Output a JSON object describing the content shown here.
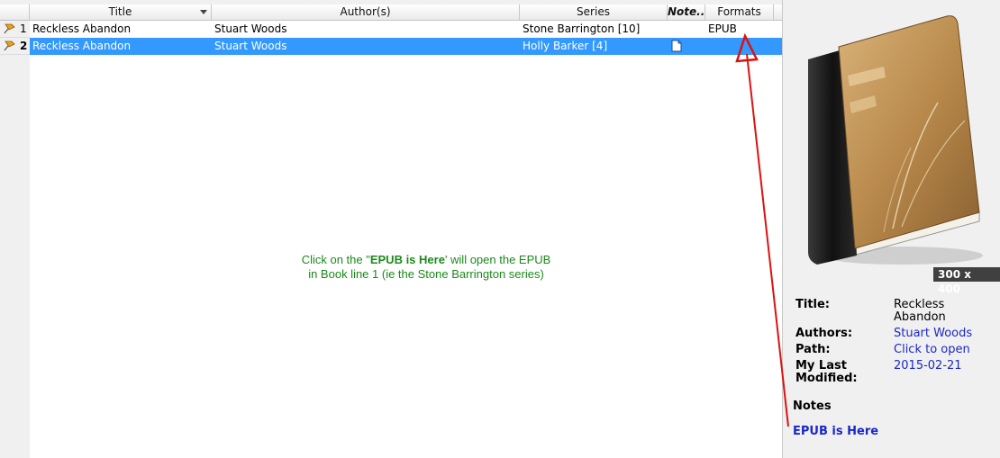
{
  "columns": {
    "title": "Title",
    "authors": "Author(s)",
    "series": "Series",
    "notes": "Note...",
    "formats": "Formats"
  },
  "rows": [
    {
      "num": "1",
      "title": "Reckless Abandon",
      "author": "Stuart Woods",
      "series": "Stone Barrington [10]",
      "formats": "EPUB",
      "has_note": false,
      "selected": false
    },
    {
      "num": "2",
      "title": "Reckless Abandon",
      "author": "Stuart Woods",
      "series": "Holly Barker [4]",
      "formats": "",
      "has_note": true,
      "selected": true
    }
  ],
  "annotation": {
    "line1_pre": "Click on the \"",
    "line1_bold": "EPUB is Here",
    "line1_post": "' will open the EPUB",
    "line2": "in Book line 1 (ie the Stone Barrington series)"
  },
  "details": {
    "cover_size": "300 x 400",
    "title_label": "Title:",
    "title_value": "Reckless Abandon",
    "authors_label": "Authors:",
    "authors_value": "Stuart Woods",
    "path_label": "Path:",
    "path_value": "Click to open",
    "modified_label": "My Last Modified:",
    "modified_value": "2015-02-21",
    "notes_heading": "Notes",
    "notes_link": "EPUB is Here"
  },
  "colors": {
    "selection": "#3399ff",
    "link": "#1a28c8",
    "annotation": "#1a8a1a",
    "arrow": "#dd1111"
  },
  "icons": {
    "row_marker": "pin-icon",
    "note": "document-icon",
    "sort": "sort-down-icon"
  }
}
